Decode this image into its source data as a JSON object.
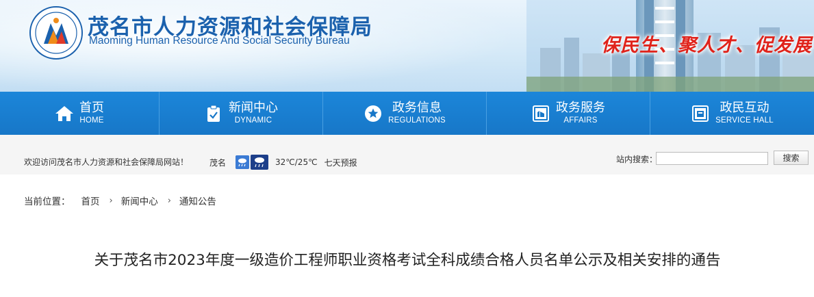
{
  "header": {
    "title_cn": "茂名市人力资源和社会保障局",
    "title_en": "Maoming Human Resource And Social Security Bureau",
    "slogan": "保民生、聚人才、促发展",
    "logo_icon": "bureau-emblem-icon",
    "brand_color": "#1b61ad",
    "slogan_color": "#e0231b"
  },
  "nav": {
    "items": [
      {
        "cn": "首页",
        "en": "HOME",
        "icon": "home-icon"
      },
      {
        "cn": "新闻中心",
        "en": "DYNAMIC",
        "icon": "clipboard-icon"
      },
      {
        "cn": "政务信息",
        "en": "REGULATIONS",
        "icon": "star-icon"
      },
      {
        "cn": "政务服务",
        "en": "AFFAIRS",
        "icon": "hand-service-icon"
      },
      {
        "cn": "政民互动",
        "en": "SERVICE HALL",
        "icon": "interaction-icon"
      }
    ],
    "bg_color": "#1777c8"
  },
  "infobar": {
    "welcome": "欢迎访问茂名市人力资源和社会保障局网站！",
    "city": "茂名",
    "temperature": "32℃/25℃",
    "forecast_link": "七天预报",
    "search_label": "站内搜索：",
    "search_value": "",
    "search_button": "搜索"
  },
  "breadcrumb": {
    "prefix": "当前位置：",
    "items": [
      "首页",
      "新闻中心",
      "通知公告"
    ]
  },
  "article": {
    "title": "关于茂名市2023年度一级造价工程师职业资格考试全科成绩合格人员名单公示及相关安排的通告"
  }
}
